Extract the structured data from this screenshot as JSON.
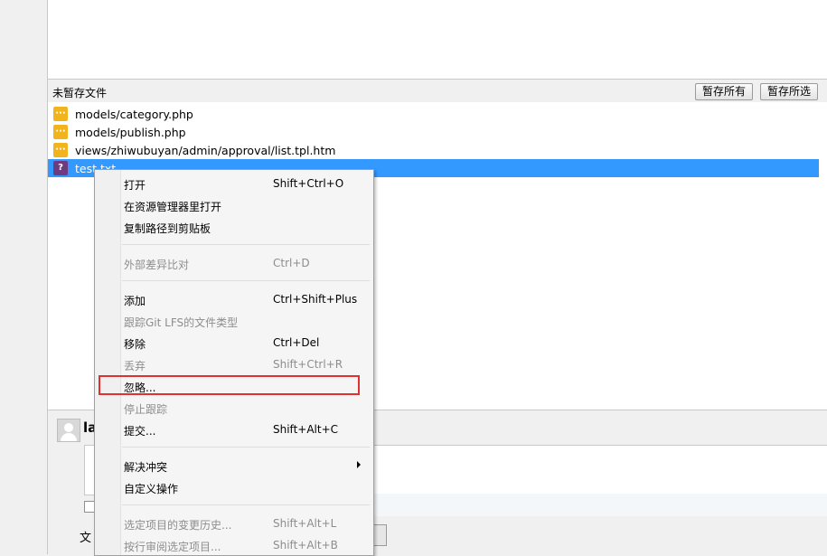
{
  "unstaged": {
    "title": "未暂存文件",
    "stage_all_label": "暂存所有",
    "stage_selected_label": "暂存所选"
  },
  "files": [
    {
      "name": "models/category.php",
      "status_icon": "modified-icon",
      "icon_glyph": "···",
      "selected": false
    },
    {
      "name": "models/publish.php",
      "status_icon": "modified-icon",
      "icon_glyph": "···",
      "selected": false
    },
    {
      "name": "views/zhiwubuyan/admin/approval/list.tpl.htm",
      "status_icon": "modified-icon",
      "icon_glyph": "···",
      "selected": false
    },
    {
      "name": "test.txt",
      "status_icon": "unknown-icon",
      "icon_glyph": "?",
      "selected": true
    }
  ],
  "commit": {
    "user_name": "la",
    "bottom_label": "文"
  },
  "context_menu": {
    "items": [
      {
        "label": "打开",
        "shortcut": "Shift+Ctrl+O",
        "enabled": true
      },
      {
        "label": "在资源管理器里打开",
        "shortcut": "",
        "enabled": true
      },
      {
        "label": "复制路径到剪贴板",
        "shortcut": "",
        "enabled": true
      },
      {
        "label": "外部差异比对",
        "shortcut": "Ctrl+D",
        "enabled": false
      },
      {
        "label": "添加",
        "shortcut": "Ctrl+Shift+Plus",
        "enabled": true
      },
      {
        "label": "跟踪Git LFS的文件类型",
        "shortcut": "",
        "enabled": false
      },
      {
        "label": "移除",
        "shortcut": "Ctrl+Del",
        "enabled": true
      },
      {
        "label": "丢弃",
        "shortcut": "Shift+Ctrl+R",
        "enabled": false
      },
      {
        "label": "忽略...",
        "shortcut": "",
        "enabled": true
      },
      {
        "label": "停止跟踪",
        "shortcut": "",
        "enabled": false
      },
      {
        "label": "提交...",
        "shortcut": "Shift+Alt+C",
        "enabled": true
      },
      {
        "label": "解决冲突",
        "shortcut": "",
        "enabled": true
      },
      {
        "label": "自定义操作",
        "shortcut": "",
        "enabled": true
      },
      {
        "label": "选定项目的变更历史...",
        "shortcut": "Shift+Alt+L",
        "enabled": false
      },
      {
        "label": "按行审阅选定项目...",
        "shortcut": "Shift+Alt+B",
        "enabled": false
      }
    ]
  },
  "colors": {
    "selection": "#3399ff",
    "highlight_box": "#e03030",
    "modified_icon": "#f2b41c",
    "unknown_icon": "#6d3b7f"
  }
}
